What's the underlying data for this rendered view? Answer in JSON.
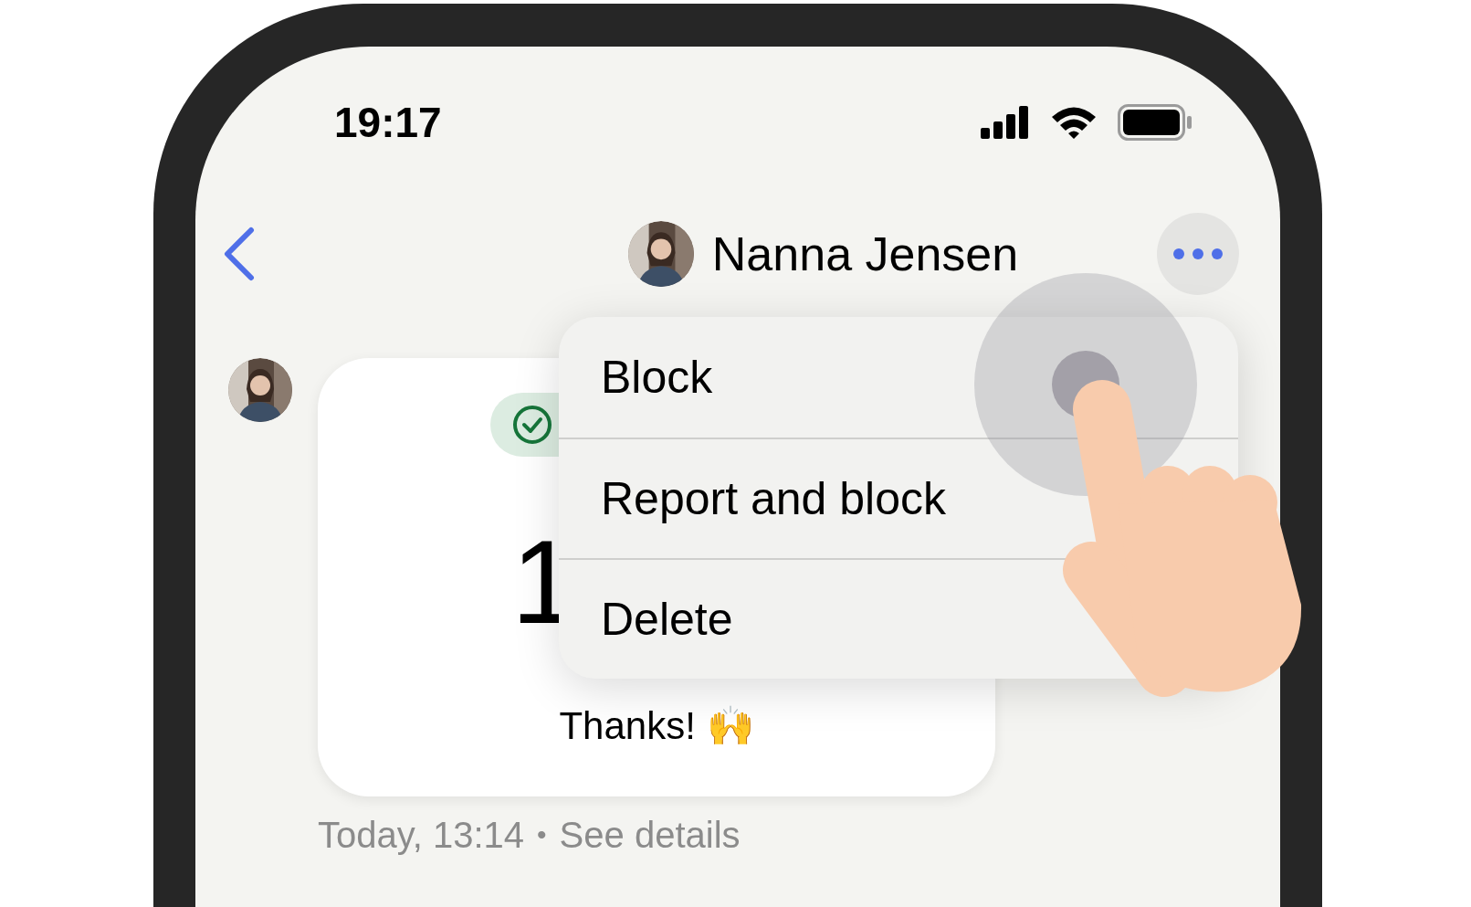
{
  "status_bar": {
    "time": "19:17"
  },
  "header": {
    "contact_name": "Nanna Jensen"
  },
  "message": {
    "big_text": "1",
    "text": "Thanks! 🙌",
    "timestamp": "Today, 13:14",
    "separator": "•",
    "link": "See details"
  },
  "menu": {
    "items": [
      {
        "label": "Block"
      },
      {
        "label": "Report and block"
      },
      {
        "label": "Delete"
      }
    ]
  }
}
